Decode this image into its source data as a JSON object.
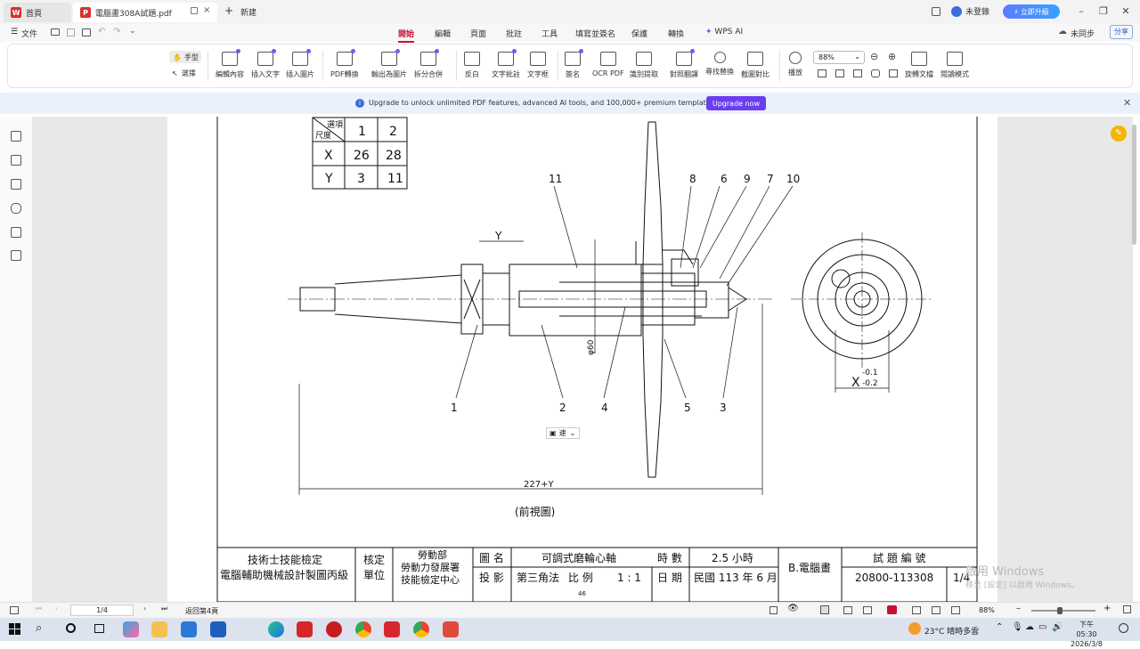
{
  "tabs": {
    "home_label": "首頁",
    "doc_label": "電腦畫308A試題.pdf",
    "new_tab_label": "新建"
  },
  "topbar": {
    "user_label": "未登錄",
    "upgrade_label": "立即升級"
  },
  "menu": {
    "file_label": "文件",
    "items": [
      "開始",
      "編輯",
      "頁面",
      "批註",
      "工具",
      "填寫並簽名",
      "保護",
      "轉換",
      "WPS AI"
    ],
    "active": "開始",
    "sync_label": "未同步",
    "share_label": "分享"
  },
  "ribbon": {
    "hand_label": "手型",
    "select_label": "選擇",
    "tools": [
      "編輯內容",
      "插入文字",
      "插入圖片",
      "PDF轉換",
      "輸出為圖片",
      "拆分合併",
      "反白",
      "文字批註",
      "文字框",
      "簽名",
      "OCR PDF",
      "識別提取",
      "對照翻譯",
      "尋找替換",
      "截圖對比",
      "播放",
      "旋轉文檔",
      "閱讀模式"
    ],
    "zoom_value": "88%"
  },
  "banner": {
    "text": "Upgrade to unlock unlimited PDF features, advanced AI tools, and 100,000+ premium templates.",
    "button_label": "Upgrade now"
  },
  "drawing": {
    "option_table": {
      "header_top": "選項",
      "header_bottom": "尺度",
      "columns": [
        "1",
        "2"
      ],
      "rows": [
        {
          "label": "X",
          "values": [
            "26",
            "28"
          ]
        },
        {
          "label": "Y",
          "values": [
            "3",
            "11"
          ]
        }
      ]
    },
    "part_numbers_top": [
      "11",
      "8",
      "6",
      "9",
      "7",
      "10"
    ],
    "part_numbers_bottom": [
      "1",
      "2",
      "4",
      "5",
      "3"
    ],
    "dim_y": "Y",
    "dim_diameter": "φ60",
    "dim_length": "227+Y",
    "dim_x": "X",
    "tol_upper": "-0.1",
    "tol_lower": "-0.2",
    "view_caption": "(前視圖)",
    "page_footer_number": "46",
    "float_toolbar_label": "速"
  },
  "title_block": {
    "exam_line1": "技術士技能檢定",
    "exam_line2": "電腦輔助機械設計製圖丙級",
    "verify_label1": "核定",
    "verify_label2": "單位",
    "ministry1": "勞動部",
    "ministry2": "勞動力發展署",
    "ministry3": "技能檢定中心",
    "drawing_name_label": "圖 名",
    "drawing_name": "可調式磨輪心軸",
    "time_label": "時 數",
    "time_value": "2.5 小時",
    "category": "B.電腦畫",
    "exam_no_label": "試 題 編 號",
    "projection_label": "投 影",
    "projection_value": "第三角法",
    "scale_label": "比 例",
    "scale_value": "1 : 1",
    "date_label": "日 期",
    "date_value": "民國 113 年 6 月",
    "exam_no": "20800-113308",
    "sheet": "1/4"
  },
  "watermark": {
    "line1": "啟用 Windows",
    "line2": "移至 [設定] 以啟用 Windows。"
  },
  "statusbar": {
    "page_value": "1/4",
    "back_label": "返回第4頁",
    "zoom": "88%"
  },
  "taskbar": {
    "weather": "23°C  晴時多雲",
    "time": "下午 05:30",
    "date": "2026/3/8"
  }
}
